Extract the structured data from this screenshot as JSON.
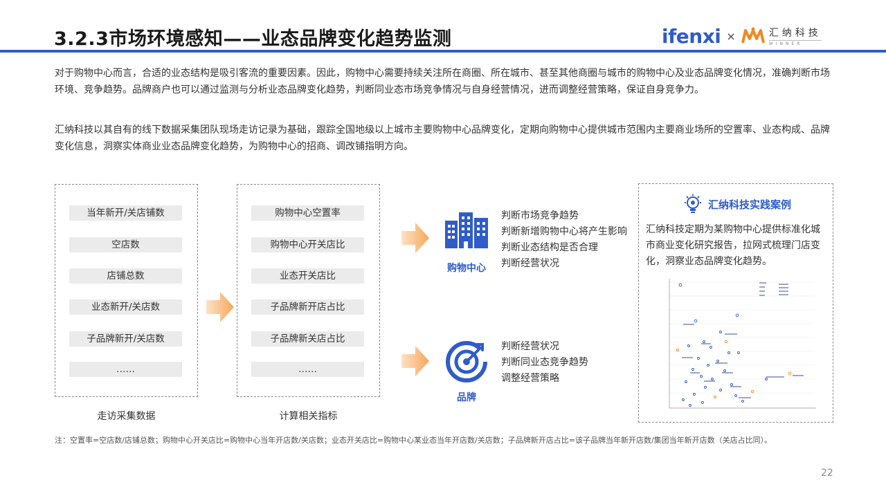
{
  "header": {
    "title": "3.2.3市场环境感知——业态品牌变化趋势监测",
    "logo_ifenxi": "ifenxi",
    "logo_separator": "×",
    "logo_winner_cn": "汇纳科技",
    "logo_winner_en": "WINNER"
  },
  "intro": {
    "paragraph1": "对于购物中心而言，合适的业态结构是吸引客流的重要因素。因此，购物中心需要持续关注所在商圈、所在城市、甚至其他商圈与城市的购物中心及业态品牌变化情况，准确判断市场环境、竞争趋势。品牌商户也可以通过监测与分析业态品牌变化趋势，判断同业态市场竞争情况与自身经营情况，进而调整经营策略，保证自身竞争力。",
    "paragraph2": "汇纳科技以其自有的线下数据采集团队现场走访记录为基础，跟踪全国地级以上城市主要购物中心品牌变化，定期向购物中心提供城市范围内主要商业场所的空置率、业态构成、品牌变化信息，洞察实体商业业态品牌变化趋势，为购物中心的招商、调改铺指明方向。"
  },
  "collected_data": {
    "caption": "走访采集数据",
    "items": [
      "当年新开/关店铺数",
      "空店数",
      "店铺总数",
      "业态新开/关店数",
      "子品牌新开/关店数",
      "……"
    ]
  },
  "computed_metrics": {
    "caption": "计算相关指标",
    "items": [
      "购物中心空置率",
      "购物中心开关店比",
      "业态开关店比",
      "子品牌新开店占比",
      "子品牌新关店占比",
      "……"
    ]
  },
  "mall": {
    "label": "购物中心",
    "icon": "building-icon",
    "judgements": [
      "判断市场竞争趋势",
      "判断新增购物中心将产生影响",
      "判断业态结构是否合理",
      "判断经营状况"
    ]
  },
  "brand": {
    "label": "品牌",
    "icon": "target-icon",
    "judgements": [
      "判断经营状况",
      "判断同业态竞争趋势",
      "调整经营策略"
    ]
  },
  "case": {
    "title": "汇纳科技实践案例",
    "icon": "lightbulb-gear-icon",
    "text": "汇纳科技定期为某购物中心提供标准化城市商业变化研究报告，拉网式梳理门店变化，洞察业态品牌变化趋势。"
  },
  "footnote": "注：空置率=空店数/店铺总数；购物中心开关店比=购物中心当年开店数/关店数；业态开关店比=购物中心某业态当年开店数/关店数；子品牌新开店占比=该子品牌当年新开店数/集团当年新开店数（关店占比同）。",
  "page_number": "22",
  "colors": {
    "accent": "#2f5cc8",
    "arrow": "#f7a75a",
    "winner_orange": "#f08a24"
  }
}
